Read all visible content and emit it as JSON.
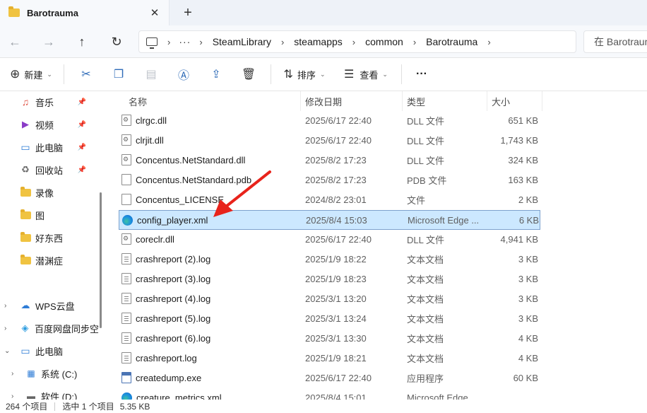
{
  "window": {
    "tab_title": "Barotrauma",
    "close_glyph": "✕",
    "new_tab_glyph": "+"
  },
  "nav": {
    "back_glyph": "←",
    "forward_glyph": "→",
    "up_glyph": "↑",
    "refresh_glyph": "↻",
    "breadcrumb_more": "···",
    "breadcrumbs": [
      "SteamLibrary",
      "steamapps",
      "common",
      "Barotrauma"
    ],
    "search_placeholder": "在 Barotrauma 中搜索"
  },
  "commands": {
    "new_label": "新建",
    "sort_label": "排序",
    "view_label": "查看",
    "more_label": "···"
  },
  "sidebar": {
    "quick_access": [
      {
        "label": "音乐",
        "icon": "music-icon",
        "pinned": true
      },
      {
        "label": "视频",
        "icon": "video-icon",
        "pinned": true
      },
      {
        "label": "此电脑",
        "icon": "computer-icon",
        "pinned": true
      },
      {
        "label": "回收站",
        "icon": "recycle-bin-icon",
        "pinned": true
      },
      {
        "label": "录像",
        "icon": "folder-icon",
        "pinned": false
      },
      {
        "label": "图",
        "icon": "folder-icon",
        "pinned": false
      },
      {
        "label": "好东西",
        "icon": "folder-icon",
        "pinned": false
      },
      {
        "label": "潜渊症",
        "icon": "folder-icon",
        "pinned": false
      }
    ],
    "tree": [
      {
        "label": "WPS云盘",
        "icon": "cloud-icon",
        "expanded": false
      },
      {
        "label": "百度网盘同步空",
        "icon": "baidu-sync-icon",
        "expanded": false
      },
      {
        "label": "此电脑",
        "icon": "computer-icon",
        "expanded": true
      },
      {
        "label": "系统 (C:)",
        "icon": "drive-icon",
        "expanded": false
      },
      {
        "label": "软件 (D:)",
        "icon": "drive-icon",
        "expanded": false
      }
    ]
  },
  "columns": {
    "name": "名称",
    "date": "修改日期",
    "type": "类型",
    "size": "大小"
  },
  "files": [
    {
      "name": "clrgc.dll",
      "date": "2025/6/17 22:40",
      "type": "DLL 文件",
      "size": "651 KB",
      "icon": "gear"
    },
    {
      "name": "clrjit.dll",
      "date": "2025/6/17 22:40",
      "type": "DLL 文件",
      "size": "1,743 KB",
      "icon": "gear"
    },
    {
      "name": "Concentus.NetStandard.dll",
      "date": "2025/8/2 17:23",
      "type": "DLL 文件",
      "size": "324 KB",
      "icon": "gear"
    },
    {
      "name": "Concentus.NetStandard.pdb",
      "date": "2025/8/2 17:23",
      "type": "PDB 文件",
      "size": "163 KB",
      "icon": "blank"
    },
    {
      "name": "Concentus_LICENSE",
      "date": "2024/8/2 23:01",
      "type": "文件",
      "size": "2 KB",
      "icon": "blank"
    },
    {
      "name": "config_player.xml",
      "date": "2025/8/4 15:03",
      "type": "Microsoft Edge ...",
      "size": "6 KB",
      "icon": "edge",
      "selected": true
    },
    {
      "name": "coreclr.dll",
      "date": "2025/6/17 22:40",
      "type": "DLL 文件",
      "size": "4,941 KB",
      "icon": "gear"
    },
    {
      "name": "crashreport (2).log",
      "date": "2025/1/9 18:22",
      "type": "文本文档",
      "size": "3 KB",
      "icon": "text"
    },
    {
      "name": "crashreport (3).log",
      "date": "2025/1/9 18:23",
      "type": "文本文档",
      "size": "3 KB",
      "icon": "text"
    },
    {
      "name": "crashreport (4).log",
      "date": "2025/3/1 13:20",
      "type": "文本文档",
      "size": "3 KB",
      "icon": "text"
    },
    {
      "name": "crashreport (5).log",
      "date": "2025/3/1 13:24",
      "type": "文本文档",
      "size": "3 KB",
      "icon": "text"
    },
    {
      "name": "crashreport (6).log",
      "date": "2025/3/1 13:30",
      "type": "文本文档",
      "size": "4 KB",
      "icon": "text"
    },
    {
      "name": "crashreport.log",
      "date": "2025/1/9 18:21",
      "type": "文本文档",
      "size": "4 KB",
      "icon": "text"
    },
    {
      "name": "createdump.exe",
      "date": "2025/6/17 22:40",
      "type": "应用程序",
      "size": "60 KB",
      "icon": "exe"
    },
    {
      "name": "creature_metrics.xml",
      "date": "2025/8/4 15:01",
      "type": "Microsoft Edge ...",
      "size": "",
      "icon": "edge"
    }
  ],
  "status": {
    "item_count": "264 个项目",
    "selected_count": "选中 1 个项目",
    "selected_size": "5.35 KB"
  },
  "colors": {
    "selection_bg": "#cce8ff",
    "selection_border": "#7da2ce",
    "annotation_arrow": "#e8231b"
  }
}
